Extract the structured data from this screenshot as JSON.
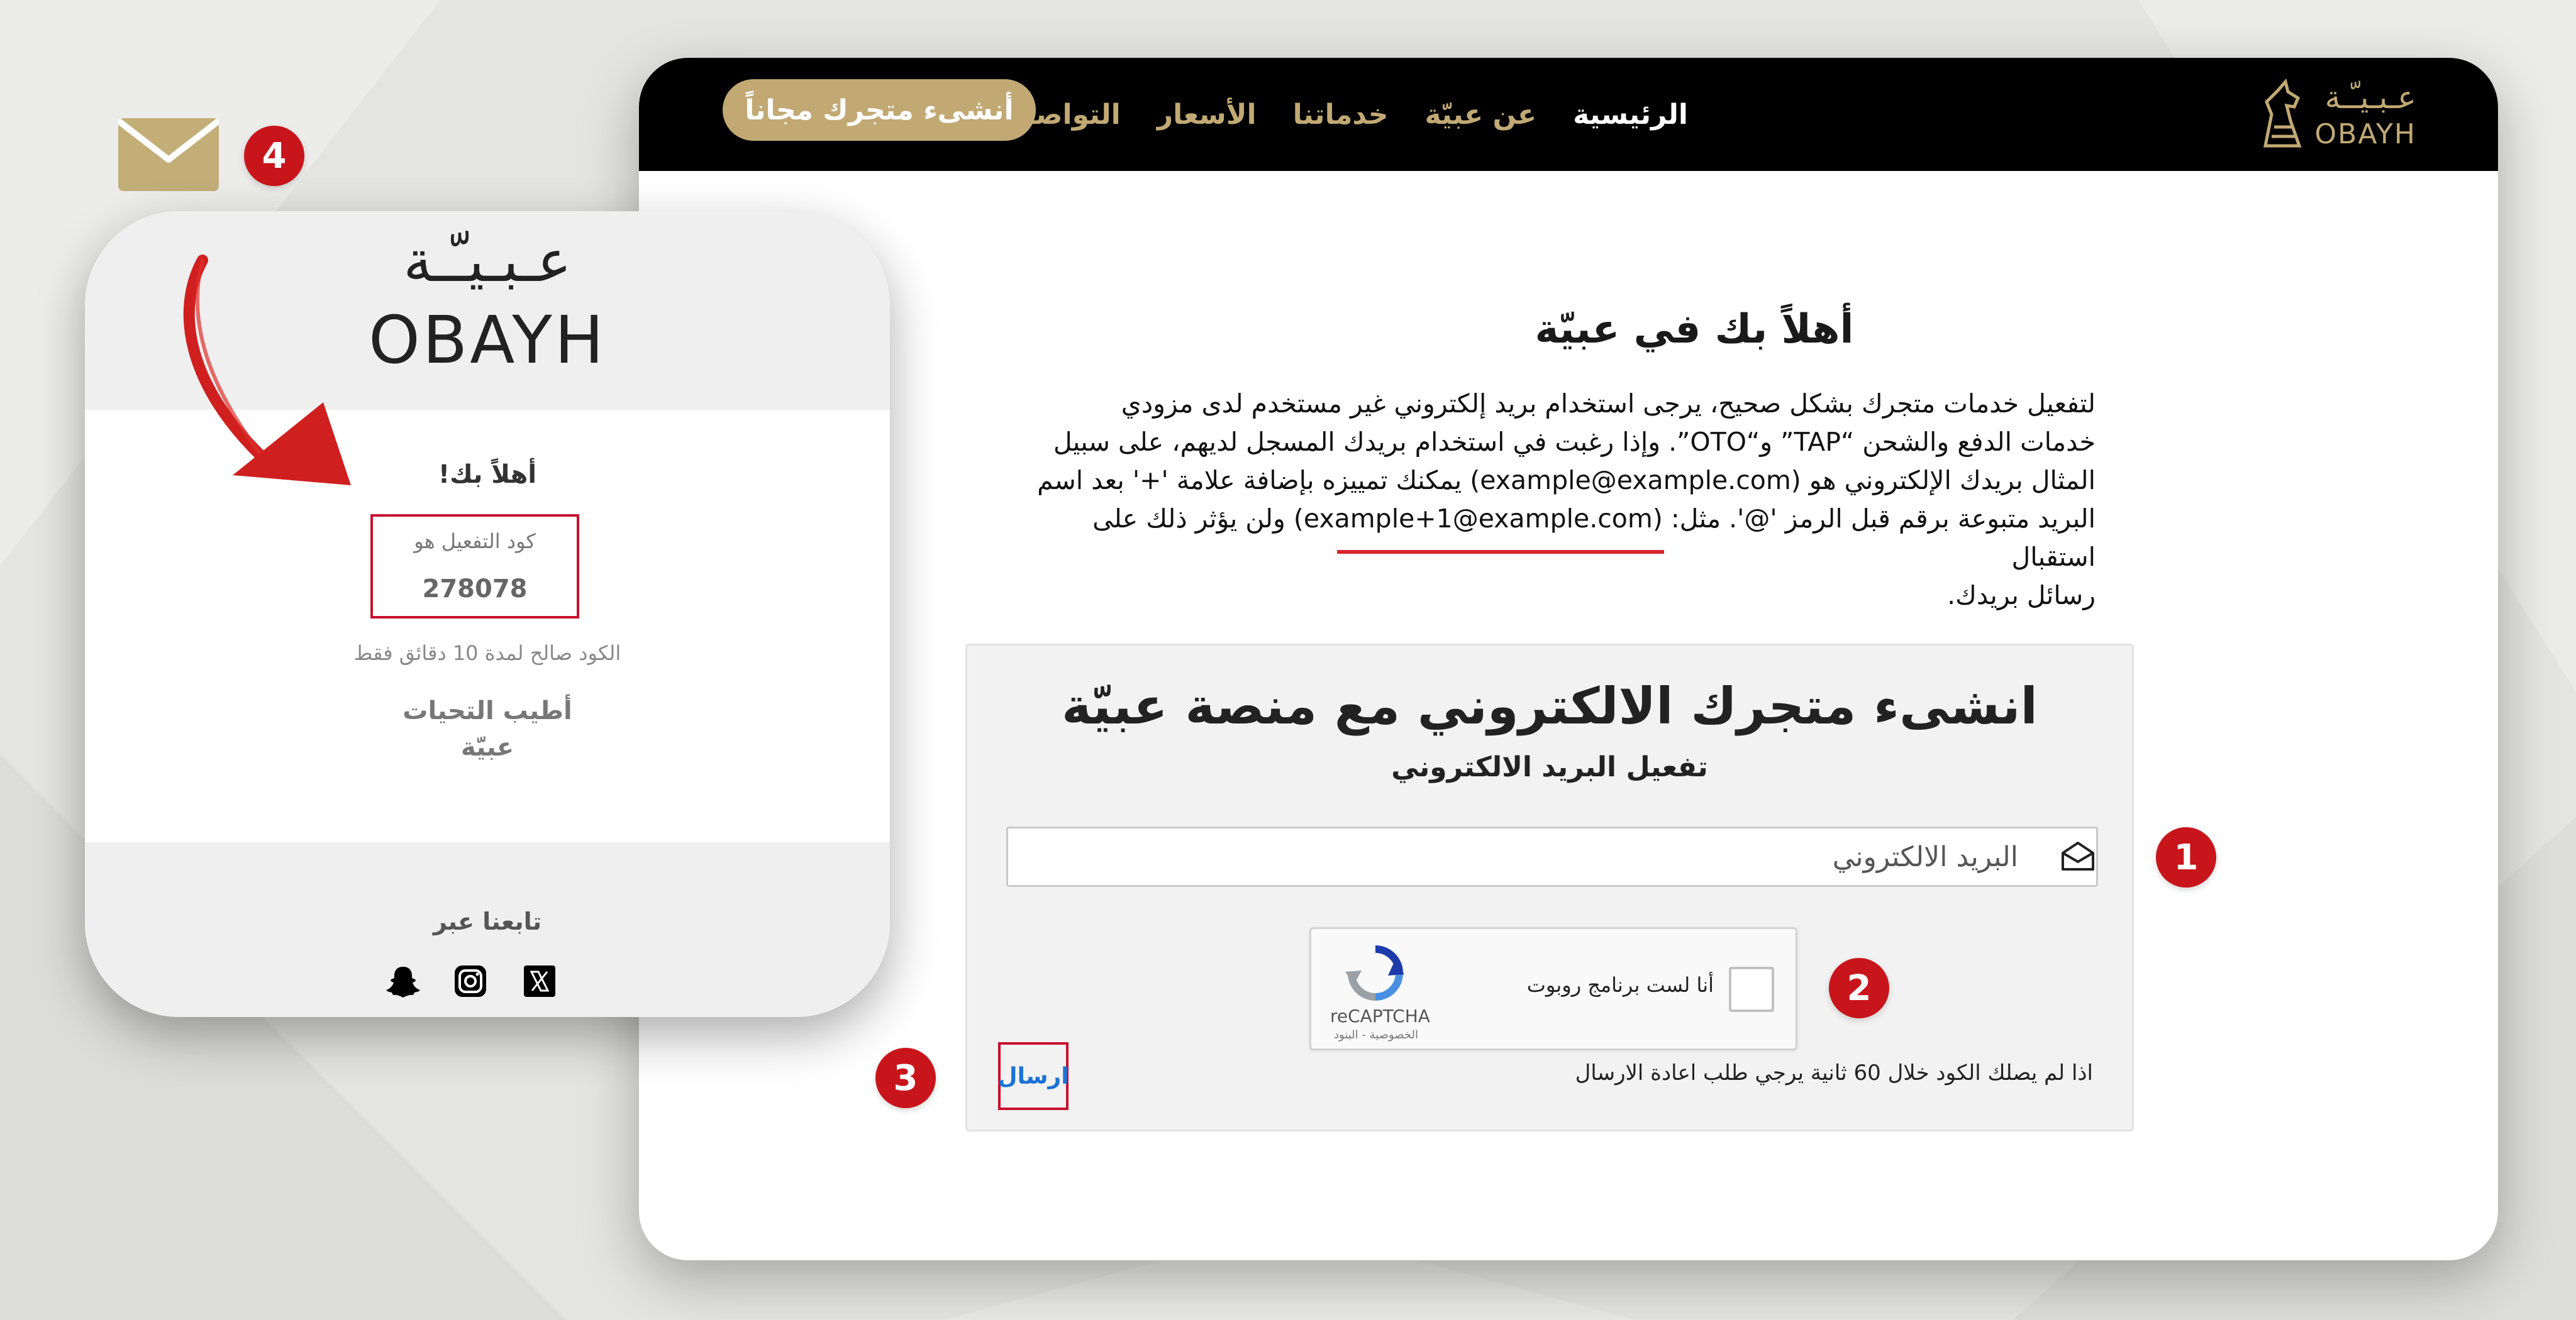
{
  "nav": {
    "logo_ar": "عـبـيـّـة",
    "logo_en": "OBAYH",
    "links": [
      "الرئيسية",
      "عن عبيّة",
      "خدماتنا",
      "الأسعار",
      "التواصل معنا"
    ],
    "cta": "أنشىء متجرك مجاناً"
  },
  "welcome": {
    "title": "أهلاً بك في عبيّة",
    "lines": [
      "لتفعيل خدمات متجرك بشكل صحيح، يرجى استخدام بريد إلكتروني غير مستخدم لدى مزودي",
      "خدمات الدفع والشحن “TAP” و“OTO”. وإذا رغبت في استخدام بريدك المسجل لديهم، على سبيل",
      "المثال بريدك الإلكتروني هو (example@example.com) يمكنك تمييزه بإضافة علامة '+' بعد اسم",
      "البريد متبوعة برقم قبل الرمز '@'. مثل: (example+1@example.com) ولن يؤثر ذلك على استقبال",
      "رسائل بريدك."
    ]
  },
  "form": {
    "title": "انشىء متجرك الالكتروني مع منصة عبيّة",
    "subtitle": "تفعيل البريد الالكتروني",
    "email_placeholder": "البريد الالكتروني",
    "captcha_label": "أنا لست برنامج روبوت",
    "captcha_brand": "reCAPTCHA",
    "captcha_privacy": "الخصوصية - البنود",
    "resend_note": "اذا لم يصلك الكود خلال 60 ثانية يرجي طلب اعادة الارسال",
    "send_label": "ارسال"
  },
  "markers": [
    "1",
    "2",
    "3",
    "4"
  ],
  "email_preview": {
    "logo_ar": "عـبـيـّـة",
    "logo_en": "OBAYH",
    "hello": "أهلاً بك!",
    "code_label": "كود التفعيل هو",
    "code": "278078",
    "validity": "الكود صالح لمدة 10 دقائق فقط",
    "regards": "أطيب التحيات",
    "signature": "عبيّة",
    "follow": "تابعنا عبر",
    "social_icons": [
      "snapchat-icon",
      "instagram-icon",
      "x-icon"
    ]
  },
  "colors": {
    "gold": "#c2a974",
    "marker_red": "#c8151b",
    "nav_bg": "#000000",
    "link_blue": "#1a73d6"
  }
}
